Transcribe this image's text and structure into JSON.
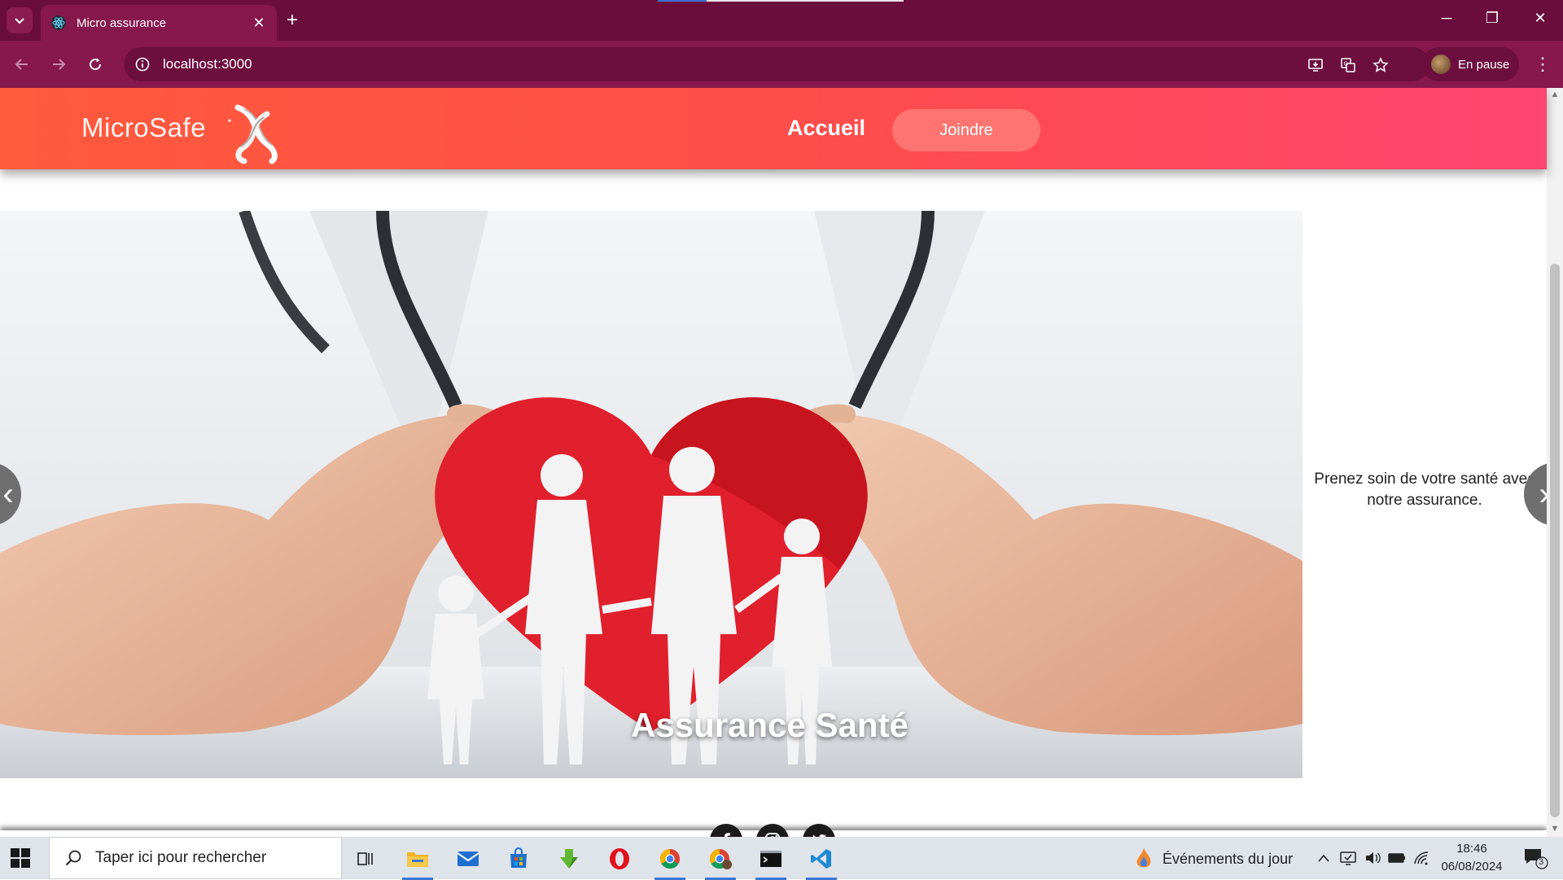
{
  "browser": {
    "tab_title": "Micro assurance",
    "url": "localhost:3000",
    "profile_label": "En pause"
  },
  "site": {
    "brand": "MicroSafe",
    "nav": {
      "home": "Accueil",
      "join": "Joindre"
    },
    "hero": {
      "caption": "Assurance Santé",
      "side_text": "Prenez soin de votre santé avec notre assurance."
    },
    "social_icons": [
      "facebook-icon",
      "instagram-icon",
      "twitter-icon"
    ],
    "colors": {
      "header_start": "#ff5a3c",
      "header_end": "#ff4470",
      "join_button": "#ff7470",
      "browser_frame": "#86184d"
    }
  },
  "taskbar": {
    "search_placeholder": "Taper ici pour rechercher",
    "events_label": "Événements du jour",
    "time": "18:46",
    "date": "06/08/2024",
    "notification_count": "3"
  }
}
